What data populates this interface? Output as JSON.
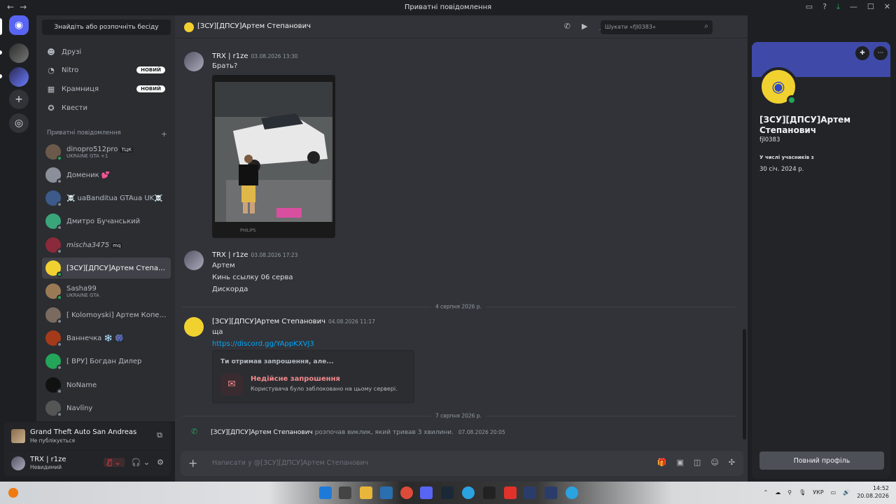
{
  "window": {
    "title": "Приватні повідомлення"
  },
  "sidebar": {
    "search_label": "Знайдіть або розпочніть бесіду",
    "nav": [
      {
        "label": "Друзі",
        "badge": ""
      },
      {
        "label": "Nitro",
        "badge": "НОВИЙ"
      },
      {
        "label": "Крамниця",
        "badge": "НОВИЙ"
      },
      {
        "label": "Квести",
        "badge": ""
      }
    ],
    "dm_header": "Приватні повідомлення",
    "dms": [
      {
        "name": "dinopro512pro",
        "tag": "ТЦК",
        "sub": "UKRAINE GTA +1",
        "color": "#6b5a4a"
      },
      {
        "name": "Доменик 💕",
        "tag": "",
        "sub": "",
        "color": "#8a8f99"
      },
      {
        "name": "☠️ uaBanditua GTAua UK☠️",
        "tag": "",
        "sub": "",
        "color": "#3c5a8a"
      },
      {
        "name": "Дмитро Бучанський",
        "tag": "",
        "sub": "",
        "color": "#3aa57a"
      },
      {
        "name": "mischa3475",
        "tag": "mq",
        "sub": "",
        "color": "#8a2a3a"
      },
      {
        "name": "[ЗСУ][ДПСУ]Артем Степанович",
        "tag": "",
        "sub": "",
        "color": "#f1d12f"
      },
      {
        "name": "Sasha99",
        "tag": "",
        "sub": "UKRAINE GTA",
        "color": "#9a7a55"
      },
      {
        "name": "[ Kolomoyski] Артем Копелюх",
        "tag": "",
        "sub": "",
        "color": "#7a6a60"
      },
      {
        "name": "Ваннечка ❄️ 🎆",
        "tag": "",
        "sub": "",
        "color": "#a53a1a"
      },
      {
        "name": "[ ВРУ] Богдан Дилер",
        "tag": "",
        "sub": "",
        "color": "#23a55a"
      },
      {
        "name": "NoName",
        "tag": "",
        "sub": "",
        "color": "#111111"
      },
      {
        "name": "Navlїny",
        "tag": "",
        "sub": "",
        "color": "#555555"
      }
    ]
  },
  "activity": {
    "game": "Grand Theft Auto San Andreas",
    "status": "Не публікується"
  },
  "user": {
    "name": "TRX | r1ze",
    "status": "Невидимий"
  },
  "chat": {
    "header_name": "[ЗСУ][ДПСУ]Артем Степанович",
    "search_placeholder": "Шукати «fjl0383»",
    "messages": [
      {
        "author": "TRX | r1ze",
        "time": "03.08.2026 13:30",
        "lines": [
          "Брать?"
        ]
      },
      {
        "author": "TRX | r1ze",
        "time": "03.08.2026 17:23",
        "lines": [
          "Артем",
          "Кинь ссылку 06 серва",
          "Дискорда"
        ]
      },
      {
        "author": "[ЗСУ][ДПСУ]Артем Степанович",
        "time": "04.08.2026 11:17",
        "lines": [
          "ща"
        ],
        "link": "https://discord.gg/YAppKXVJ3"
      }
    ],
    "attachment_watermark": "PHILIPS",
    "divider1": "4 серпня 2026 р.",
    "divider2": "7 серпня 2026 р.",
    "invite": {
      "title": "Ти отримав запрошення, але...",
      "name": "Недійсне запрошення",
      "desc": "Користувача було заблоковано на цьому сервері."
    },
    "call": {
      "who": "[ЗСУ][ДПСУ]Артем Степанович",
      "text": "розпочав виклик, який тривав 3 хвилини.",
      "time": "07.08.2026 20:05"
    },
    "input_placeholder": "Написати у @[ЗСУ][ДПСУ]Артем Степанович"
  },
  "profile": {
    "name": "[ЗСУ][ДПСУ]Артем Степанович",
    "username": "fjl0383",
    "member_since_label": "У числі учасників з",
    "member_since": "30 січ. 2024 р.",
    "full_profile": "Повний профіль"
  },
  "taskbar": {
    "lang": "УКР",
    "time": "14:52",
    "date": "20.08.2026"
  }
}
